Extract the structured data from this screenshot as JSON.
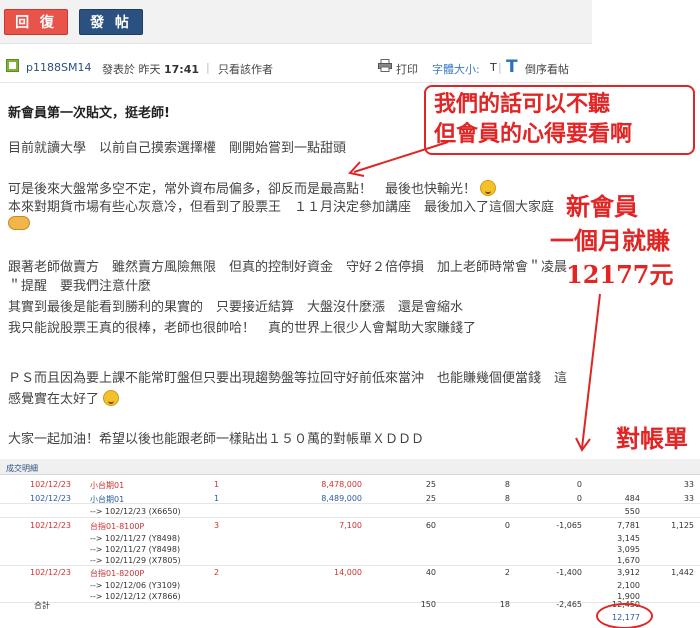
{
  "toolbar": {
    "reply_label": "回 復",
    "post_label": "發 帖"
  },
  "post_meta": {
    "username": "p1188SM14",
    "posted_prefix": "發表於 昨天",
    "posted_time": "17:41",
    "separator": "|",
    "author_only": "只看該作者",
    "print": "打印",
    "font_size_label": "字體大小:",
    "font_small": "T",
    "font_big": "T",
    "reverse": "倒序看帖"
  },
  "post": {
    "title": "新會員第一次貼文，挺老師!",
    "lines": [
      "目前就讀大學　以前自己摸索選擇權　剛開始嘗到一點甜頭",
      "可是後來大盤常多空不定，常外資布局偏多，卻反而是最高點！　最後也快輸光！",
      "本來對期貨市場有些心灰意冷，但看到了股票王　１１月決定參加講座　最後加入了這個大家庭",
      "跟著老師做賣方　雖然賣方風險無限　但真的控制好資金　守好２倍停損　加上老師時常會＂凌晨",
      "＂提醒　要我們注意什麼",
      "其實到最後是能看到勝利的果實的　只要接近結算　大盤沒什麼漲　還是會縮水",
      "我只能說股票王真的很棒，老師也很帥哈！　真的世界上很少人會幫助大家賺錢了",
      "ＰＳ而且因為要上課不能常盯盤但只要出現趨勢盤等拉回守好前低來當沖　也能賺幾個便當錢　這",
      "感覺實在太好了",
      "大家一起加油！希望以後也能跟老師一樣貼出１５０萬的對帳單ＸＤＤＤ"
    ]
  },
  "annotations": {
    "box_line1": "我們的話可以不聽",
    "box_line2": "但會員的心得要看啊",
    "side_line1": "新會員",
    "side_line2": "一個月就賺",
    "side_line3": "12177元",
    "statement_label": "對帳單"
  },
  "statement": {
    "header": "成交明細",
    "rows": [
      {
        "date": "102/12/23",
        "name": "小台期01",
        "q": "1",
        "amt": "8,478,000",
        "c1": "25",
        "c2": "8",
        "c3": "0",
        "c4": "",
        "c5": "33",
        "color": "red"
      },
      {
        "date": "102/12/23",
        "name": "小台期01",
        "q": "1",
        "amt": "8,489,000",
        "c1": "25",
        "c2": "8",
        "c3": "0",
        "c4": "484",
        "c5": "33",
        "color": "blue"
      },
      {
        "date": "",
        "name": "--> 102/12/23 (X6650)",
        "q": "",
        "amt": "",
        "c1": "",
        "c2": "",
        "c3": "",
        "c4": "550",
        "c5": "",
        "color": "plain"
      },
      {
        "date": "102/12/23",
        "name": "台指01-8100P",
        "q": "3",
        "amt": "7,100",
        "c1": "60",
        "c2": "0",
        "c3": "-1,065",
        "c4": "7,781",
        "c5": "1,125",
        "color": "red"
      },
      {
        "date": "",
        "name": "--> 102/11/27 (Y8498)",
        "q": "",
        "amt": "",
        "c1": "",
        "c2": "",
        "c3": "",
        "c4": "3,145",
        "c5": "",
        "color": "plain"
      },
      {
        "date": "",
        "name": "--> 102/11/27 (Y8498)",
        "q": "",
        "amt": "",
        "c1": "",
        "c2": "",
        "c3": "",
        "c4": "3,095",
        "c5": "",
        "color": "plain"
      },
      {
        "date": "",
        "name": "--> 102/11/29 (X7805)",
        "q": "",
        "amt": "",
        "c1": "",
        "c2": "",
        "c3": "",
        "c4": "1,670",
        "c5": "",
        "color": "plain"
      },
      {
        "date": "102/12/23",
        "name": "台指01-8200P",
        "q": "2",
        "amt": "14,000",
        "c1": "40",
        "c2": "2",
        "c3": "-1,400",
        "c4": "3,912",
        "c5": "1,442",
        "color": "red"
      },
      {
        "date": "",
        "name": "--> 102/12/06 (Y3109)",
        "q": "",
        "amt": "",
        "c1": "",
        "c2": "",
        "c3": "",
        "c4": "2,100",
        "c5": "",
        "color": "plain"
      },
      {
        "date": "",
        "name": "--> 102/12/12 (X7866)",
        "q": "",
        "amt": "",
        "c1": "",
        "c2": "",
        "c3": "",
        "c4": "1,900",
        "c5": "",
        "color": "plain"
      }
    ],
    "total_label": "合計",
    "total_c1": "150",
    "total_c2": "18",
    "total_c3": "-2,465",
    "total_c4": "12,450",
    "final_total": "12,177"
  }
}
